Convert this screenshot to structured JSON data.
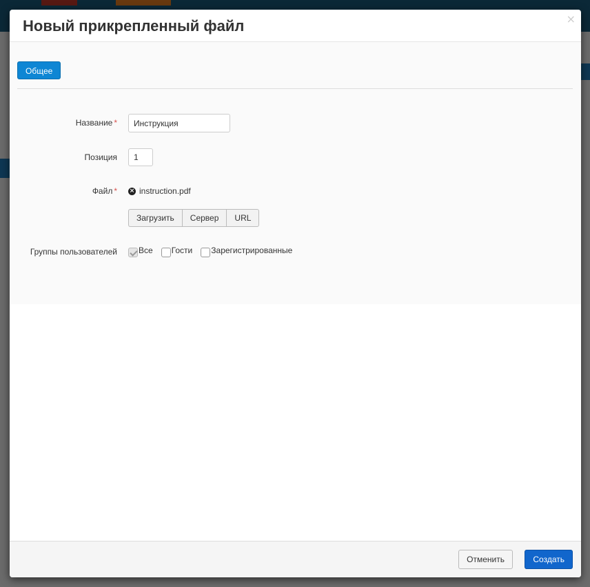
{
  "modal": {
    "title": "Новый прикрепленный файл",
    "close_glyph": "×"
  },
  "tabs": [
    {
      "label": "Общее",
      "active": true
    }
  ],
  "form": {
    "name": {
      "label": "Название",
      "required": "*",
      "value": "Инструкция"
    },
    "position": {
      "label": "Позиция",
      "value": "1"
    },
    "file": {
      "label": "Файл",
      "required": "*",
      "filename": "instruction.pdf",
      "remove_icon": "x-circle-icon",
      "buttons": [
        "Загрузить",
        "Сервер",
        "URL"
      ]
    },
    "user_groups": {
      "label": "Группы пользователей",
      "options": [
        {
          "label": "Все",
          "checked": true,
          "disabled": true
        },
        {
          "label": "Гости",
          "checked": false
        },
        {
          "label": "Зарегистрированные",
          "checked": false
        }
      ]
    }
  },
  "footer": {
    "cancel_label": "Отменить",
    "create_label": "Создать"
  },
  "colors": {
    "primary": "#0e86d4",
    "create_button": "#1166cc",
    "required_marker": "#d9534f"
  }
}
